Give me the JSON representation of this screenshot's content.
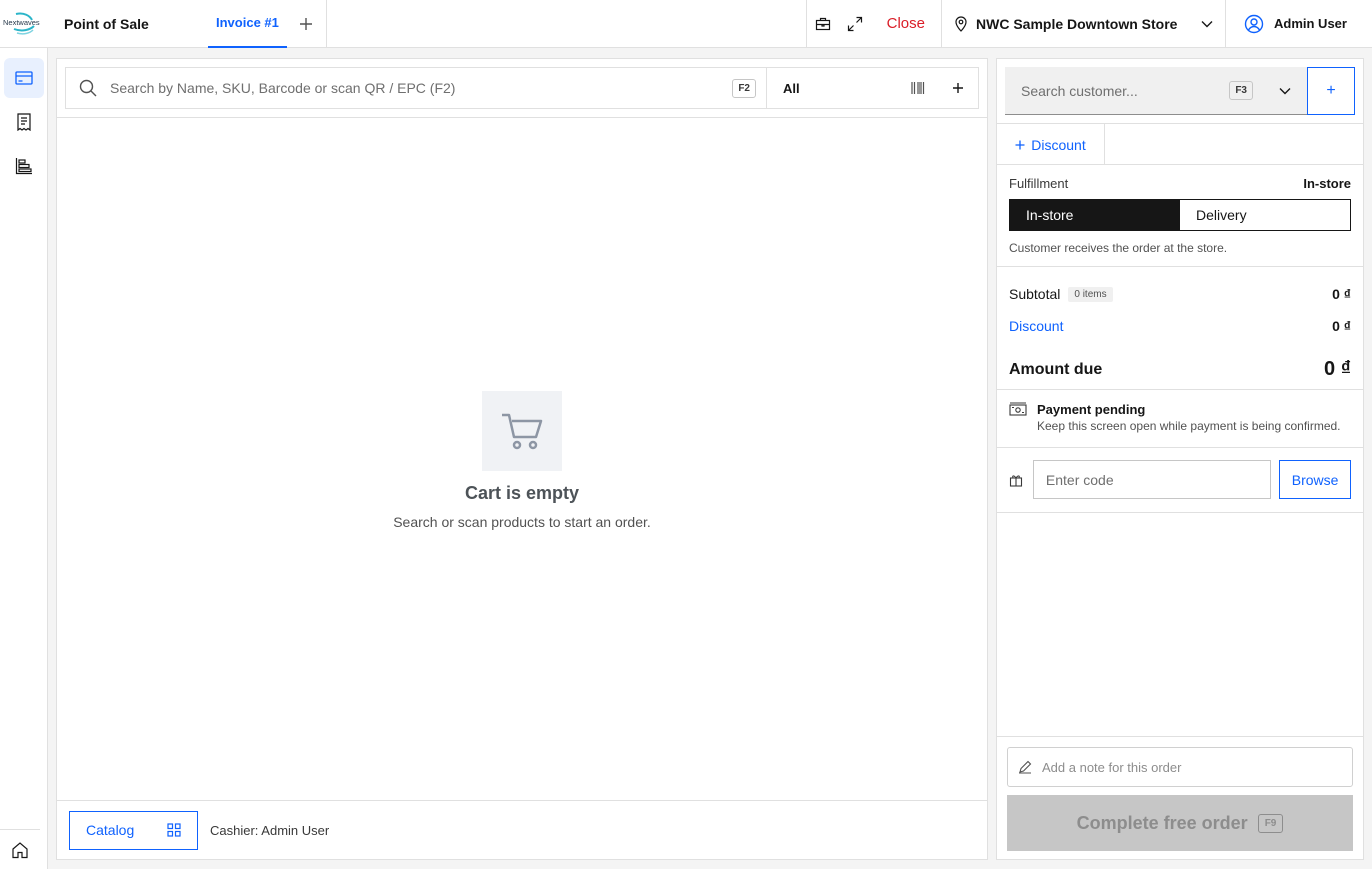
{
  "header": {
    "app_title": "Point of Sale",
    "tab_label": "Invoice #1",
    "close_label": "Close",
    "store_name": "NWC Sample Downtown Store",
    "user_name": "Admin User",
    "logo_text": "Nextwaves"
  },
  "search": {
    "placeholder": "Search by Name, SKU, Barcode or scan QR / EPC (F2)",
    "shortcut": "F2",
    "category": "All"
  },
  "empty_state": {
    "title": "Cart is empty",
    "subtitle": "Search or scan products to start an order."
  },
  "footer": {
    "catalog_label": "Catalog",
    "cashier": "Cashier: Admin User"
  },
  "customer": {
    "placeholder": "Search customer...",
    "shortcut": "F3",
    "add_label": "+"
  },
  "discount_button": "Discount",
  "fulfillment": {
    "label": "Fulfillment",
    "value": "In-store",
    "options": [
      "In-store",
      "Delivery"
    ],
    "note": "Customer receives the order at the store."
  },
  "totals": {
    "subtotal_label": "Subtotal",
    "items": "0 items",
    "subtotal_value": "0 ₫",
    "discount_label": "Discount",
    "discount_value": "0 ₫",
    "due_label": "Amount due",
    "due_value": "0 ₫"
  },
  "payment": {
    "title": "Payment pending",
    "subtitle": "Keep this screen open while payment is being confirmed."
  },
  "promo": {
    "placeholder": "Enter code",
    "browse_label": "Browse"
  },
  "order_note": {
    "placeholder": "Add a note for this order"
  },
  "complete": {
    "label": "Complete free order",
    "shortcut": "F9"
  },
  "colors": {
    "accent": "#0f62fe",
    "danger": "#da1e28",
    "dark": "#161616"
  }
}
